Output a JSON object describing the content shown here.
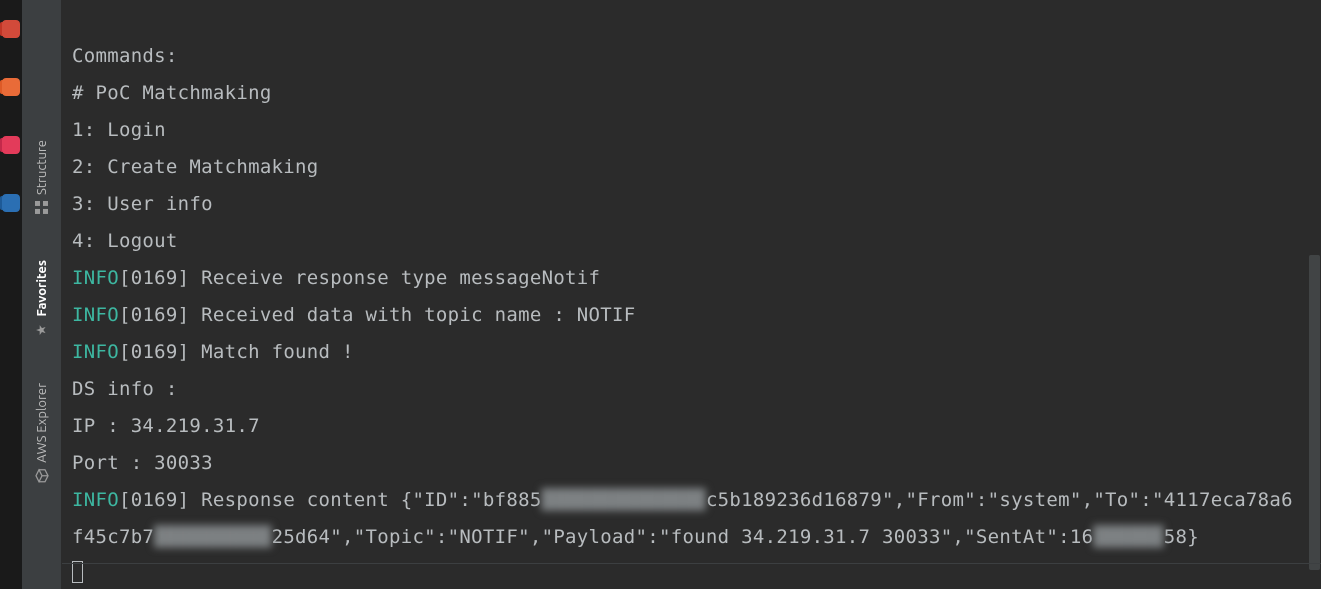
{
  "launcher": {
    "items": [
      "app-1",
      "app-2",
      "app-3",
      "app-4"
    ]
  },
  "side_tools": {
    "structure": {
      "label": "Structure",
      "icon": "structure-icon"
    },
    "favorites": {
      "label": "Favorites",
      "icon": "star-icon"
    },
    "aws_explorer": {
      "label": "AWS Explorer",
      "icon": "cube-icon"
    }
  },
  "console": {
    "lines": [
      {
        "text": "Commands:"
      },
      {
        "text": "# PoC Matchmaking"
      },
      {
        "text": "1: Login"
      },
      {
        "text": "2: Create Matchmaking"
      },
      {
        "text": "3: User info"
      },
      {
        "text": "4: Logout"
      },
      {
        "level": "INFO",
        "ts": "[0169]",
        "msg": " Receive response type messageNotif"
      },
      {
        "level": "INFO",
        "ts": "[0169]",
        "msg": " Received data with topic name : NOTIF"
      },
      {
        "level": "INFO",
        "ts": "[0169]",
        "msg": " Match found !"
      },
      {
        "text": "DS info :"
      },
      {
        "text": "IP : 34.219.31.7"
      },
      {
        "text": "Port : 30033"
      },
      {
        "level": "INFO",
        "ts": "[0169]",
        "parts": [
          " Response content {\"ID\":\"bf885",
          "██████████████",
          "c5b189236d16879\",\"From\":\"system\",\"To\":\"4117eca78a6"
        ],
        "blur_idx": 1
      },
      {
        "parts": [
          "f45c7b7",
          "██████████",
          "25d64\",\"Topic\":\"NOTIF\",\"Payload\":\"found 34.219.31.7 30033\",\"SentAt\":16",
          "██████",
          "58}"
        ],
        "blur_idx": [
          1,
          3
        ]
      }
    ],
    "cursor": true
  },
  "response_content": {
    "ID": "bf885…c5b189236d16879",
    "From": "system",
    "To": "4117eca78a6f45c7b7…25d64",
    "Topic": "NOTIF",
    "Payload": "found 34.219.31.7 30033",
    "SentAt": "16…58"
  },
  "ds_info": {
    "ip": "34.219.31.7",
    "port": "30033"
  },
  "colors": {
    "info": "#3db7a1",
    "text": "#b8bcbf",
    "bg": "#2b2b2b",
    "tool_bg": "#3c3f41"
  }
}
